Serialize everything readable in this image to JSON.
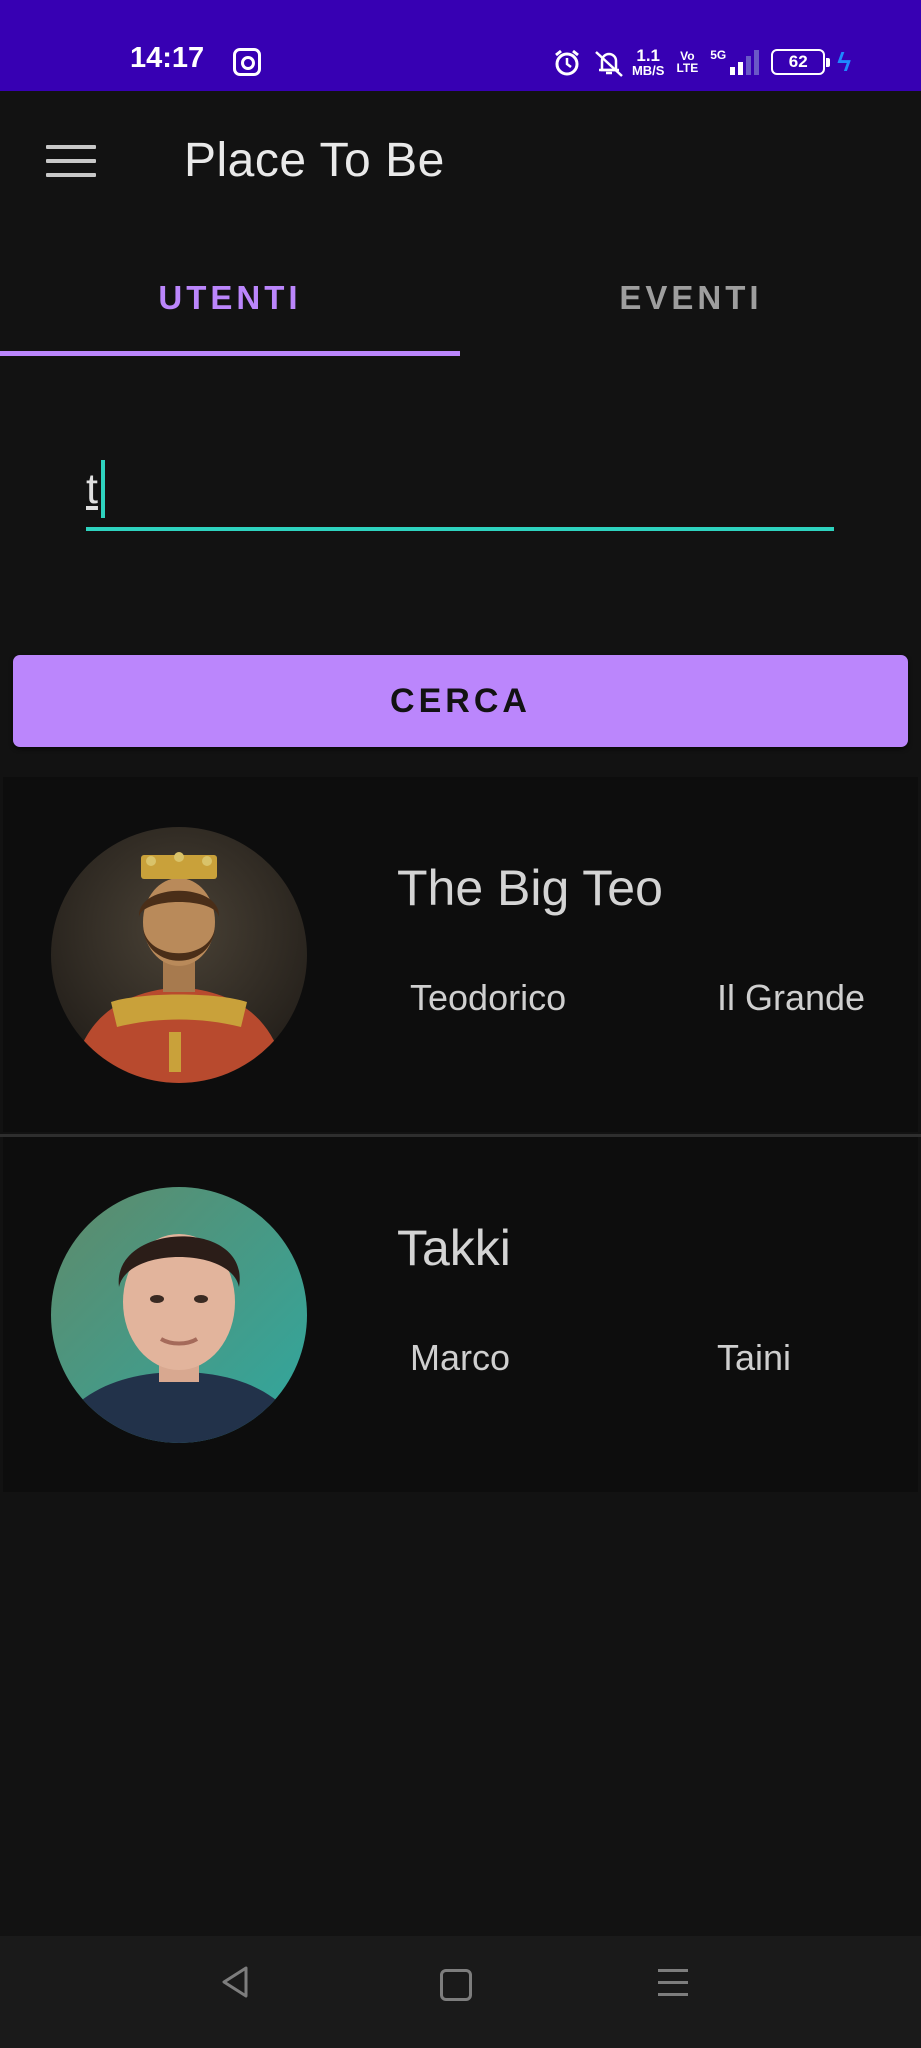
{
  "status_bar": {
    "time": "14:17",
    "net_speed_value": "1.1",
    "net_speed_unit": "MB/S",
    "volte_top": "Vo",
    "volte_bottom": "LTE",
    "network": "5G",
    "battery": "62",
    "icons": [
      "instagram-icon",
      "alarm-icon",
      "mute-icon",
      "signal-icon",
      "battery-icon",
      "charging-icon"
    ]
  },
  "app_bar": {
    "title": "Place To Be",
    "menu_icon": "hamburger-icon"
  },
  "tabs": [
    {
      "label": "UTENTI",
      "selected": true
    },
    {
      "label": "EVENTI",
      "selected": false
    }
  ],
  "search": {
    "value": "t",
    "placeholder": ""
  },
  "search_button": {
    "label": "CERCA"
  },
  "results": [
    {
      "nickname": "The Big Teo",
      "first_name": "Teodorico",
      "last_name": "Il Grande"
    },
    {
      "nickname": "Takki",
      "first_name": "Marco",
      "last_name": "Taini"
    }
  ],
  "colors": {
    "status_bar": "#3700b3",
    "accent": "#bb86fc",
    "input_underline": "#2ed3bf",
    "background": "#121212"
  },
  "nav_bar": {
    "icons": [
      "back-icon",
      "home-icon",
      "recents-icon"
    ]
  }
}
